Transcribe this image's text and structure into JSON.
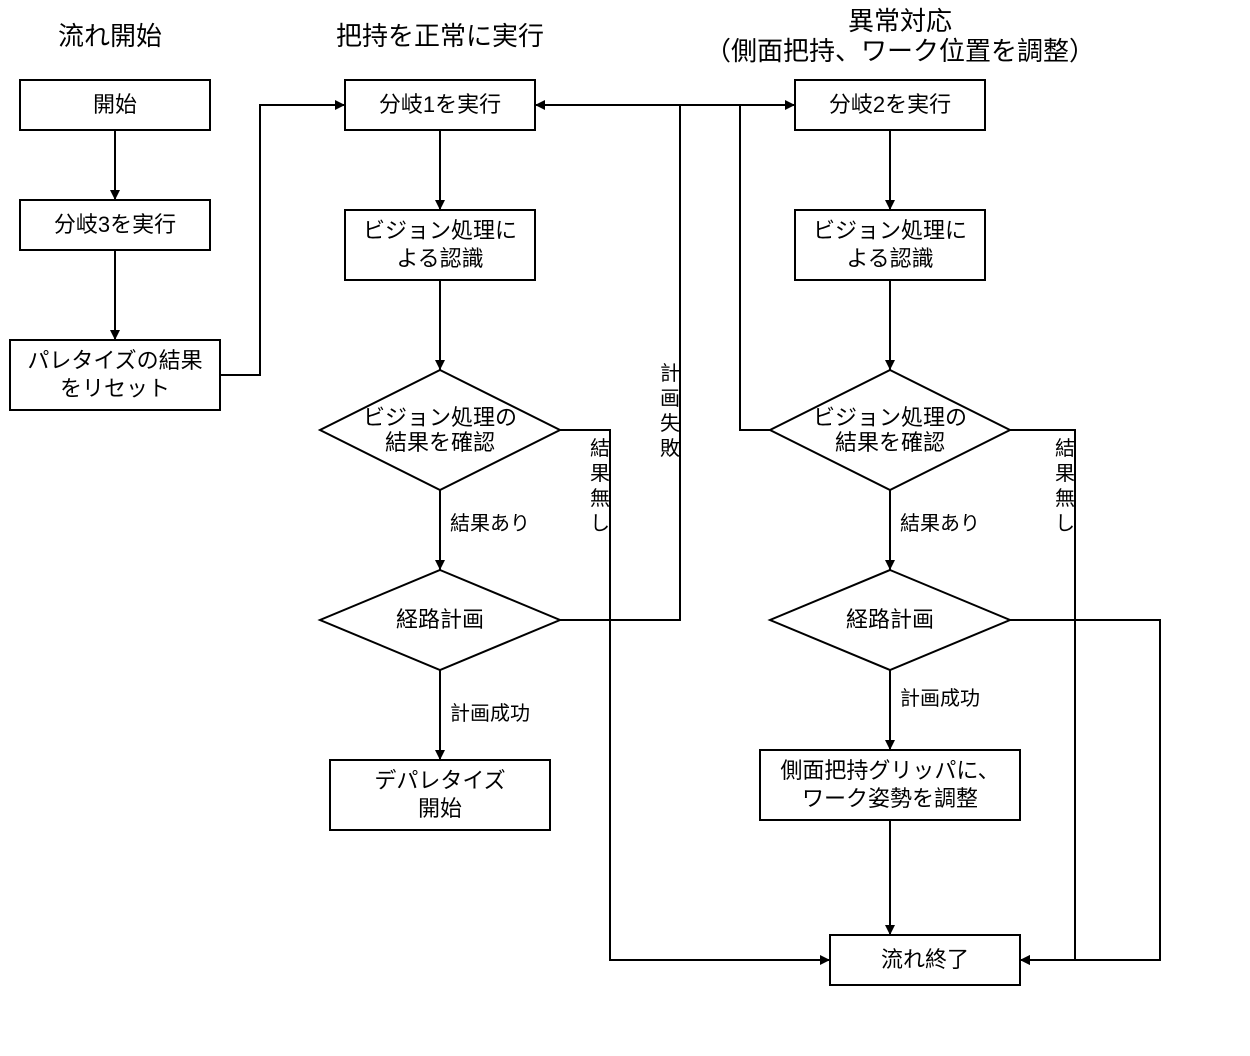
{
  "headers": {
    "left": "流れ開始",
    "mid": "把持を正常に実行",
    "right1": "異常対応",
    "right2": "（側面把持、ワーク位置を調整）"
  },
  "col1": {
    "start": "開始",
    "branch3": "分岐3を実行",
    "reset1": "パレタイズの結果",
    "reset2": "をリセット"
  },
  "col2": {
    "branch1": "分岐1を実行",
    "vision1a": "ビジョン処理に",
    "vision1b": "よる認識",
    "check1a": "ビジョン処理の",
    "check1b": "結果を確認",
    "plan": "経路計画",
    "depal1": "デパレタイズ",
    "depal2": "開始",
    "resYes": "結果あり",
    "planOk": "計画成功"
  },
  "col3": {
    "branch2": "分岐2を実行",
    "vision2a": "ビジョン処理に",
    "vision2b": "よる認識",
    "check2a": "ビジョン処理の",
    "check2b": "結果を確認",
    "plan": "経路計画",
    "adj1": "側面把持グリッパに、",
    "adj2": "ワーク姿勢を調整",
    "end": "流れ終了",
    "resYes": "結果あり",
    "planOk": "計画成功"
  },
  "edges": {
    "noResult": "結果無し",
    "planFail": "計画失敗"
  }
}
